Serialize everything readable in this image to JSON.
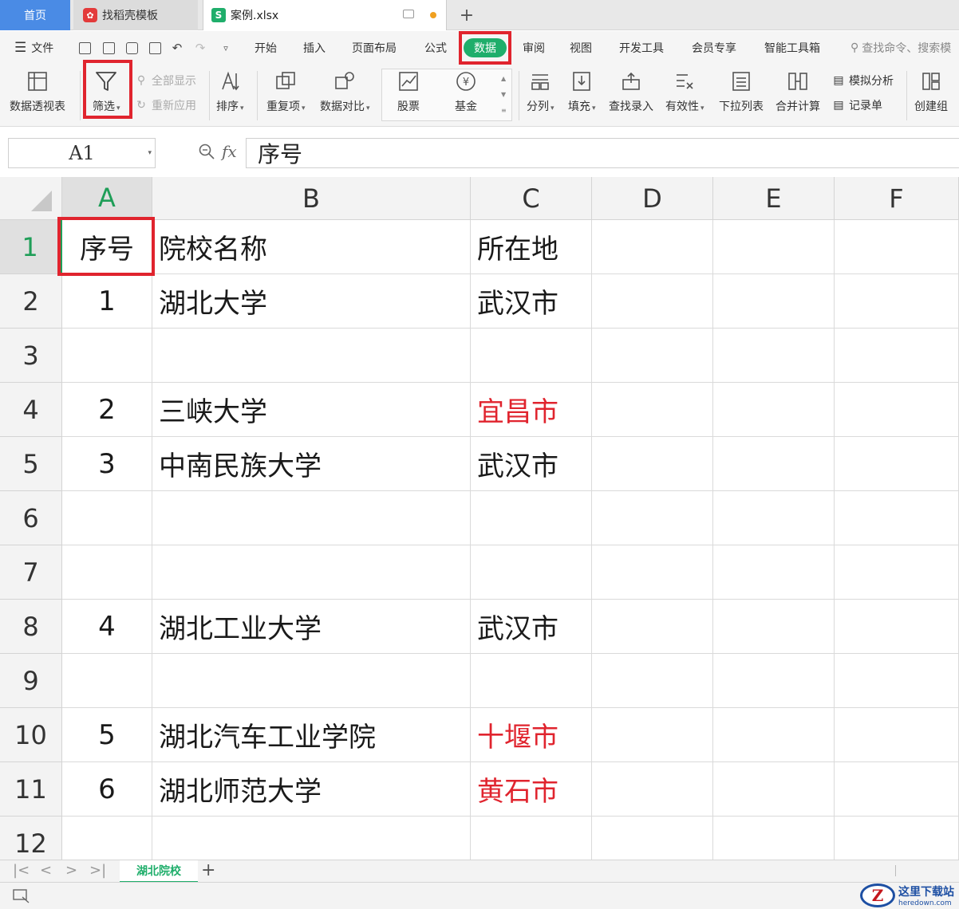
{
  "tabs": {
    "home": "首页",
    "template": "找稻壳模板",
    "file": "案例.xlsx",
    "new_tab": "+"
  },
  "menu": {
    "file": "文件",
    "items": [
      "开始",
      "插入",
      "页面布局",
      "公式",
      "数据",
      "审阅",
      "视图",
      "开发工具",
      "会员专享",
      "智能工具箱"
    ],
    "active": "数据",
    "search_placeholder": "查找命令、搜索模"
  },
  "ribbon": {
    "pivot": "数据透视表",
    "filter": "筛选",
    "show_all": "全部显示",
    "reapply": "重新应用",
    "sort": "排序",
    "duplicates": "重复项",
    "compare": "数据对比",
    "stock": "股票",
    "fund": "基金",
    "split": "分列",
    "fill": "填充",
    "lookup": "查找录入",
    "validity": "有效性",
    "dropdown": "下拉列表",
    "consolidate": "合并计算",
    "simulate": "模拟分析",
    "record": "记录单",
    "group": "创建组"
  },
  "formula_bar": {
    "name_box": "A1",
    "fx": "fx",
    "content": "序号"
  },
  "columns": [
    "A",
    "B",
    "C",
    "D",
    "E",
    "F"
  ],
  "rows": [
    {
      "num": "1",
      "a": "序号",
      "b": "院校名称",
      "c": "所在地",
      "c_red": false
    },
    {
      "num": "2",
      "a": "1",
      "b": "湖北大学",
      "c": "武汉市",
      "c_red": false
    },
    {
      "num": "3",
      "a": "",
      "b": "",
      "c": "",
      "c_red": false
    },
    {
      "num": "4",
      "a": "2",
      "b": "三峡大学",
      "c": "宜昌市",
      "c_red": true
    },
    {
      "num": "5",
      "a": "3",
      "b": "中南民族大学",
      "c": "武汉市",
      "c_red": false
    },
    {
      "num": "6",
      "a": "",
      "b": "",
      "c": "",
      "c_red": false
    },
    {
      "num": "7",
      "a": "",
      "b": "",
      "c": "",
      "c_red": false
    },
    {
      "num": "8",
      "a": "4",
      "b": "湖北工业大学",
      "c": "武汉市",
      "c_red": false
    },
    {
      "num": "9",
      "a": "",
      "b": "",
      "c": "",
      "c_red": false
    },
    {
      "num": "10",
      "a": "5",
      "b": "湖北汽车工业学院",
      "c": "十堰市",
      "c_red": true
    },
    {
      "num": "11",
      "a": "6",
      "b": "湖北师范大学",
      "c": "黄石市",
      "c_red": true
    },
    {
      "num": "12",
      "a": "",
      "b": "",
      "c": "",
      "c_red": false
    }
  ],
  "sheet_tabs": {
    "active": "湖北院校",
    "add": "+"
  },
  "watermark": {
    "logo": "Z",
    "title": "这里下载站",
    "url": "heredown.com"
  },
  "colors": {
    "accent_green": "#1fae6b",
    "highlight_red": "#e0242e",
    "home_tab_blue": "#4a8be5"
  }
}
